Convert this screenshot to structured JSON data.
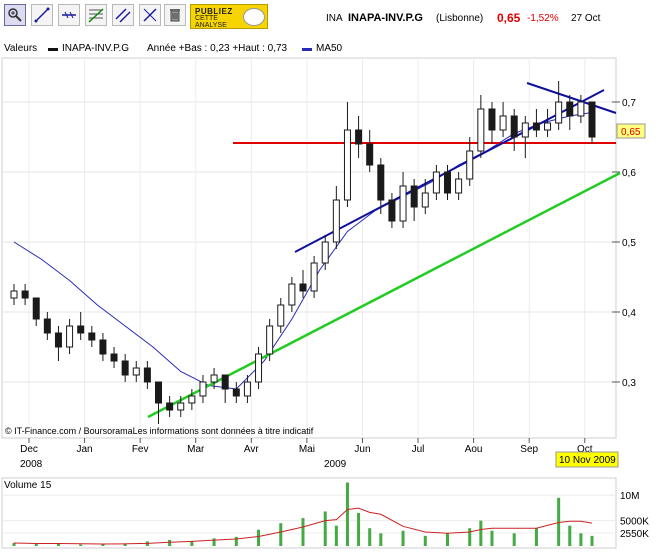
{
  "toolbar": {
    "tools": [
      "zoom-icon",
      "line-tool-icon",
      "horizontal-line-icon",
      "fibonacci-icon",
      "parallel-lines-icon",
      "channel-icon",
      "trash-icon"
    ],
    "ad": {
      "line1": "PUBLIEZ",
      "line2": "CETTE",
      "line3": "ANALYSE"
    }
  },
  "header": {
    "market_code": "INA",
    "symbol": "INAPA-INV.P.G",
    "exchange": "(Lisbonne)",
    "price": "0,65",
    "change": "-1,52%",
    "date": "27 Oct"
  },
  "legend": {
    "values_label": "Valeurs",
    "series_name": "INAPA-INV.P.G",
    "range_text": "Année +Bas : 0,23 +Haut : 0,73",
    "ma_label": "MA50"
  },
  "footer_note": "© IT-Finance.com / BoursoramaLes informations sont données à titre indicatif",
  "date_badge": "10 Nov 2009",
  "colors": {
    "candle": "#1a1a1a",
    "ma50": "#2a2ab8",
    "support_line": "#1010a0",
    "resistance_line": "#e00000",
    "long_trend": "#22cc22",
    "volume": "#44aa44",
    "volume_ma": "#cc2222",
    "price_badge": "#ffff80",
    "date_badge": "#ffff00"
  },
  "chart_data": [
    {
      "type": "candlestick",
      "title": "INAPA-INV.P.G",
      "ylim": [
        0.22,
        0.76
      ],
      "y_ticks": [
        "0,3",
        "0,4",
        "0,5",
        "0,6",
        "0,7"
      ],
      "y_tick_values": [
        0.3,
        0.4,
        0.5,
        0.6,
        0.7
      ],
      "last_price_label": "0,65",
      "last_price": 0.65,
      "x_months": [
        "Dec",
        "Jan",
        "Fev",
        "Mar",
        "Avr",
        "Mai",
        "Jun",
        "Jul",
        "Aou",
        "Sep",
        "Oct"
      ],
      "x_years": [
        "2008",
        "2009"
      ],
      "grid": true,
      "series_ma": [
        {
          "m": 0.0,
          "v": 0.5
        },
        {
          "m": 0.5,
          "v": 0.475
        },
        {
          "m": 1.0,
          "v": 0.445
        },
        {
          "m": 1.5,
          "v": 0.41
        },
        {
          "m": 2.0,
          "v": 0.38
        },
        {
          "m": 2.5,
          "v": 0.35
        },
        {
          "m": 3.0,
          "v": 0.315
        },
        {
          "m": 3.5,
          "v": 0.295
        },
        {
          "m": 4.0,
          "v": 0.29
        },
        {
          "m": 4.5,
          "v": 0.33
        },
        {
          "m": 5.0,
          "v": 0.39
        },
        {
          "m": 5.5,
          "v": 0.46
        },
        {
          "m": 6.0,
          "v": 0.515
        },
        {
          "m": 6.5,
          "v": 0.545
        },
        {
          "m": 7.0,
          "v": 0.565
        },
        {
          "m": 7.5,
          "v": 0.585
        },
        {
          "m": 8.0,
          "v": 0.61
        },
        {
          "m": 8.5,
          "v": 0.63
        },
        {
          "m": 9.0,
          "v": 0.655
        },
        {
          "m": 9.5,
          "v": 0.67
        },
        {
          "m": 10.0,
          "v": 0.68
        },
        {
          "m": 10.4,
          "v": 0.685
        }
      ],
      "candles": [
        {
          "m": 0.0,
          "o": 0.42,
          "c": 0.43,
          "h": 0.44,
          "l": 0.41
        },
        {
          "m": 0.2,
          "o": 0.43,
          "c": 0.42,
          "h": 0.44,
          "l": 0.41
        },
        {
          "m": 0.4,
          "o": 0.42,
          "c": 0.39,
          "h": 0.42,
          "l": 0.38
        },
        {
          "m": 0.6,
          "o": 0.39,
          "c": 0.37,
          "h": 0.4,
          "l": 0.36
        },
        {
          "m": 0.8,
          "o": 0.37,
          "c": 0.35,
          "h": 0.38,
          "l": 0.33
        },
        {
          "m": 1.0,
          "o": 0.35,
          "c": 0.38,
          "h": 0.39,
          "l": 0.34
        },
        {
          "m": 1.2,
          "o": 0.38,
          "c": 0.37,
          "h": 0.4,
          "l": 0.36
        },
        {
          "m": 1.4,
          "o": 0.37,
          "c": 0.36,
          "h": 0.38,
          "l": 0.35
        },
        {
          "m": 1.6,
          "o": 0.36,
          "c": 0.34,
          "h": 0.37,
          "l": 0.33
        },
        {
          "m": 1.8,
          "o": 0.34,
          "c": 0.33,
          "h": 0.35,
          "l": 0.32
        },
        {
          "m": 2.0,
          "o": 0.33,
          "c": 0.31,
          "h": 0.34,
          "l": 0.3
        },
        {
          "m": 2.2,
          "o": 0.31,
          "c": 0.32,
          "h": 0.33,
          "l": 0.3
        },
        {
          "m": 2.4,
          "o": 0.32,
          "c": 0.3,
          "h": 0.33,
          "l": 0.29
        },
        {
          "m": 2.6,
          "o": 0.3,
          "c": 0.27,
          "h": 0.3,
          "l": 0.24
        },
        {
          "m": 2.8,
          "o": 0.27,
          "c": 0.26,
          "h": 0.28,
          "l": 0.25
        },
        {
          "m": 3.0,
          "o": 0.26,
          "c": 0.27,
          "h": 0.28,
          "l": 0.25
        },
        {
          "m": 3.2,
          "o": 0.27,
          "c": 0.28,
          "h": 0.29,
          "l": 0.26
        },
        {
          "m": 3.4,
          "o": 0.28,
          "c": 0.3,
          "h": 0.31,
          "l": 0.27
        },
        {
          "m": 3.6,
          "o": 0.3,
          "c": 0.31,
          "h": 0.32,
          "l": 0.29
        },
        {
          "m": 3.8,
          "o": 0.31,
          "c": 0.29,
          "h": 0.31,
          "l": 0.27
        },
        {
          "m": 4.0,
          "o": 0.29,
          "c": 0.28,
          "h": 0.3,
          "l": 0.27
        },
        {
          "m": 4.2,
          "o": 0.28,
          "c": 0.3,
          "h": 0.31,
          "l": 0.27
        },
        {
          "m": 4.4,
          "o": 0.3,
          "c": 0.34,
          "h": 0.35,
          "l": 0.29
        },
        {
          "m": 4.6,
          "o": 0.34,
          "c": 0.38,
          "h": 0.39,
          "l": 0.33
        },
        {
          "m": 4.8,
          "o": 0.38,
          "c": 0.41,
          "h": 0.42,
          "l": 0.37
        },
        {
          "m": 5.0,
          "o": 0.41,
          "c": 0.44,
          "h": 0.45,
          "l": 0.4
        },
        {
          "m": 5.2,
          "o": 0.44,
          "c": 0.43,
          "h": 0.46,
          "l": 0.42
        },
        {
          "m": 5.4,
          "o": 0.43,
          "c": 0.47,
          "h": 0.48,
          "l": 0.42
        },
        {
          "m": 5.6,
          "o": 0.47,
          "c": 0.5,
          "h": 0.51,
          "l": 0.46
        },
        {
          "m": 5.8,
          "o": 0.5,
          "c": 0.56,
          "h": 0.58,
          "l": 0.49
        },
        {
          "m": 6.0,
          "o": 0.56,
          "c": 0.66,
          "h": 0.7,
          "l": 0.55
        },
        {
          "m": 6.2,
          "o": 0.66,
          "c": 0.64,
          "h": 0.68,
          "l": 0.62
        },
        {
          "m": 6.4,
          "o": 0.64,
          "c": 0.61,
          "h": 0.66,
          "l": 0.6
        },
        {
          "m": 6.6,
          "o": 0.61,
          "c": 0.56,
          "h": 0.62,
          "l": 0.54
        },
        {
          "m": 6.8,
          "o": 0.56,
          "c": 0.53,
          "h": 0.57,
          "l": 0.52
        },
        {
          "m": 7.0,
          "o": 0.53,
          "c": 0.58,
          "h": 0.6,
          "l": 0.52
        },
        {
          "m": 7.2,
          "o": 0.58,
          "c": 0.55,
          "h": 0.59,
          "l": 0.53
        },
        {
          "m": 7.4,
          "o": 0.55,
          "c": 0.57,
          "h": 0.59,
          "l": 0.54
        },
        {
          "m": 7.6,
          "o": 0.57,
          "c": 0.6,
          "h": 0.61,
          "l": 0.56
        },
        {
          "m": 7.8,
          "o": 0.6,
          "c": 0.57,
          "h": 0.61,
          "l": 0.56
        },
        {
          "m": 8.0,
          "o": 0.57,
          "c": 0.59,
          "h": 0.6,
          "l": 0.56
        },
        {
          "m": 8.2,
          "o": 0.59,
          "c": 0.63,
          "h": 0.65,
          "l": 0.58
        },
        {
          "m": 8.4,
          "o": 0.63,
          "c": 0.69,
          "h": 0.71,
          "l": 0.62
        },
        {
          "m": 8.6,
          "o": 0.69,
          "c": 0.66,
          "h": 0.7,
          "l": 0.64
        },
        {
          "m": 8.8,
          "o": 0.66,
          "c": 0.68,
          "h": 0.7,
          "l": 0.65
        },
        {
          "m": 9.0,
          "o": 0.68,
          "c": 0.65,
          "h": 0.69,
          "l": 0.63
        },
        {
          "m": 9.2,
          "o": 0.65,
          "c": 0.67,
          "h": 0.68,
          "l": 0.62
        },
        {
          "m": 9.4,
          "o": 0.67,
          "c": 0.66,
          "h": 0.69,
          "l": 0.65
        },
        {
          "m": 9.6,
          "o": 0.66,
          "c": 0.67,
          "h": 0.69,
          "l": 0.65
        },
        {
          "m": 9.8,
          "o": 0.67,
          "c": 0.7,
          "h": 0.73,
          "l": 0.66
        },
        {
          "m": 10.0,
          "o": 0.7,
          "c": 0.68,
          "h": 0.71,
          "l": 0.66
        },
        {
          "m": 10.2,
          "o": 0.68,
          "c": 0.7,
          "h": 0.71,
          "l": 0.67
        },
        {
          "m": 10.4,
          "o": 0.7,
          "c": 0.65,
          "h": 0.7,
          "l": 0.64
        }
      ]
    },
    {
      "type": "bar",
      "title": "Volume 15",
      "y_ticks": [
        "10M",
        "5000K",
        "2550K"
      ],
      "y_tick_values": [
        10000000,
        5000000,
        2550000
      ],
      "ylim": [
        0,
        13000000
      ],
      "values_m": [
        {
          "m": 0.0,
          "v": 0.6
        },
        {
          "m": 0.4,
          "v": 0.4
        },
        {
          "m": 0.8,
          "v": 0.5
        },
        {
          "m": 1.2,
          "v": 0.3
        },
        {
          "m": 1.6,
          "v": 0.4
        },
        {
          "m": 2.0,
          "v": 0.5
        },
        {
          "m": 2.4,
          "v": 0.9
        },
        {
          "m": 2.8,
          "v": 1.2
        },
        {
          "m": 3.2,
          "v": 1.0
        },
        {
          "m": 3.6,
          "v": 1.5
        },
        {
          "m": 4.0,
          "v": 1.8
        },
        {
          "m": 4.4,
          "v": 3.2
        },
        {
          "m": 4.8,
          "v": 4.5
        },
        {
          "m": 5.2,
          "v": 5.5
        },
        {
          "m": 5.6,
          "v": 6.8
        },
        {
          "m": 5.8,
          "v": 4.0
        },
        {
          "m": 6.0,
          "v": 12.5
        },
        {
          "m": 6.2,
          "v": 6.5
        },
        {
          "m": 6.4,
          "v": 3.5
        },
        {
          "m": 6.6,
          "v": 2.5
        },
        {
          "m": 7.0,
          "v": 3.0
        },
        {
          "m": 7.4,
          "v": 2.0
        },
        {
          "m": 7.8,
          "v": 2.5
        },
        {
          "m": 8.2,
          "v": 3.5
        },
        {
          "m": 8.4,
          "v": 5.0
        },
        {
          "m": 8.6,
          "v": 3.0
        },
        {
          "m": 9.0,
          "v": 2.5
        },
        {
          "m": 9.4,
          "v": 3.5
        },
        {
          "m": 9.8,
          "v": 9.5
        },
        {
          "m": 10.0,
          "v": 4.0
        },
        {
          "m": 10.2,
          "v": 2.5
        },
        {
          "m": 10.4,
          "v": 2.0
        }
      ]
    }
  ]
}
